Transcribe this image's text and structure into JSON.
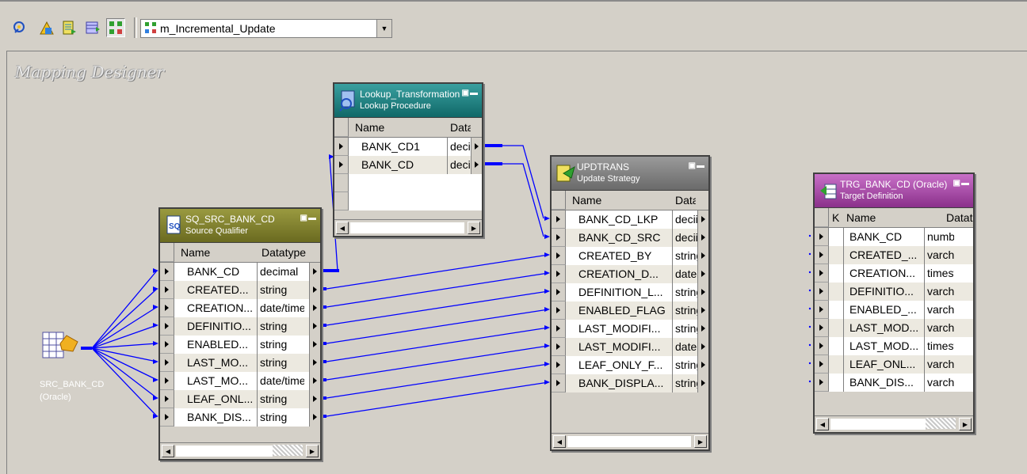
{
  "toolbar": {
    "icons": [
      "source-analyzer-icon",
      "target-designer-icon",
      "transformation-developer-icon",
      "mapplet-designer-icon",
      "mapping-designer-icon"
    ],
    "mapping_select": {
      "value": "m_Incremental_Update"
    }
  },
  "workspace": {
    "title": "Mapping Designer"
  },
  "source": {
    "label": "SRC_BANK_CD (Oracle)"
  },
  "source_qualifier": {
    "name": "SQ_SRC_BANK_CD",
    "type": "Source Qualifier",
    "col_name": "Name",
    "col_type": "Datatype",
    "rows": [
      {
        "name": "BANK_CD",
        "type": "decimal"
      },
      {
        "name": "CREATED...",
        "type": "string"
      },
      {
        "name": "CREATION...",
        "type": "date/time"
      },
      {
        "name": "DEFINITIO...",
        "type": "string"
      },
      {
        "name": "ENABLED...",
        "type": "string"
      },
      {
        "name": "LAST_MO...",
        "type": "string"
      },
      {
        "name": "LAST_MO...",
        "type": "date/time"
      },
      {
        "name": "LEAF_ONL...",
        "type": "string"
      },
      {
        "name": "BANK_DIS...",
        "type": "string"
      }
    ]
  },
  "lookup": {
    "name": "Lookup_Transformation",
    "type": "Lookup Procedure",
    "col_name": "Name",
    "col_type": "Data",
    "rows": [
      {
        "name": "BANK_CD1",
        "type": "decii"
      },
      {
        "name": "BANK_CD",
        "type": "decii"
      }
    ]
  },
  "update_strategy": {
    "name": "UPDTRANS",
    "type": "Update Strategy",
    "col_name": "Name",
    "col_type": "Data",
    "rows": [
      {
        "name": "BANK_CD_LKP",
        "type": "decii"
      },
      {
        "name": "BANK_CD_SRC",
        "type": "decii"
      },
      {
        "name": "CREATED_BY",
        "type": "string"
      },
      {
        "name": "CREATION_D...",
        "type": "date"
      },
      {
        "name": "DEFINITION_L...",
        "type": "string"
      },
      {
        "name": "ENABLED_FLAG",
        "type": "string"
      },
      {
        "name": "LAST_MODIFI...",
        "type": "string"
      },
      {
        "name": "LAST_MODIFI...",
        "type": "date"
      },
      {
        "name": "LEAF_ONLY_F...",
        "type": "string"
      },
      {
        "name": "BANK_DISPLA...",
        "type": "string"
      }
    ]
  },
  "target": {
    "name": "TRG_BANK_CD (Oracle)",
    "type": "Target Definition",
    "col_key": "K",
    "col_name": "Name",
    "col_type": "Datat",
    "rows": [
      {
        "name": "BANK_CD",
        "type": "numb"
      },
      {
        "name": "CREATED_...",
        "type": "varch"
      },
      {
        "name": "CREATION...",
        "type": "timest"
      },
      {
        "name": "DEFINITIO...",
        "type": "varch"
      },
      {
        "name": "ENABLED_...",
        "type": "varch"
      },
      {
        "name": "LAST_MOD...",
        "type": "varch"
      },
      {
        "name": "LAST_MOD...",
        "type": "timest"
      },
      {
        "name": "LEAF_ONL...",
        "type": "varch"
      },
      {
        "name": "BANK_DIS...",
        "type": "varch"
      }
    ]
  },
  "colors": {
    "link": "#0000ff",
    "sq_header": "#7a7a28",
    "lookup_header": "#1e8080",
    "update_header": "#7a7a7a",
    "target_header": "#b050b0"
  }
}
